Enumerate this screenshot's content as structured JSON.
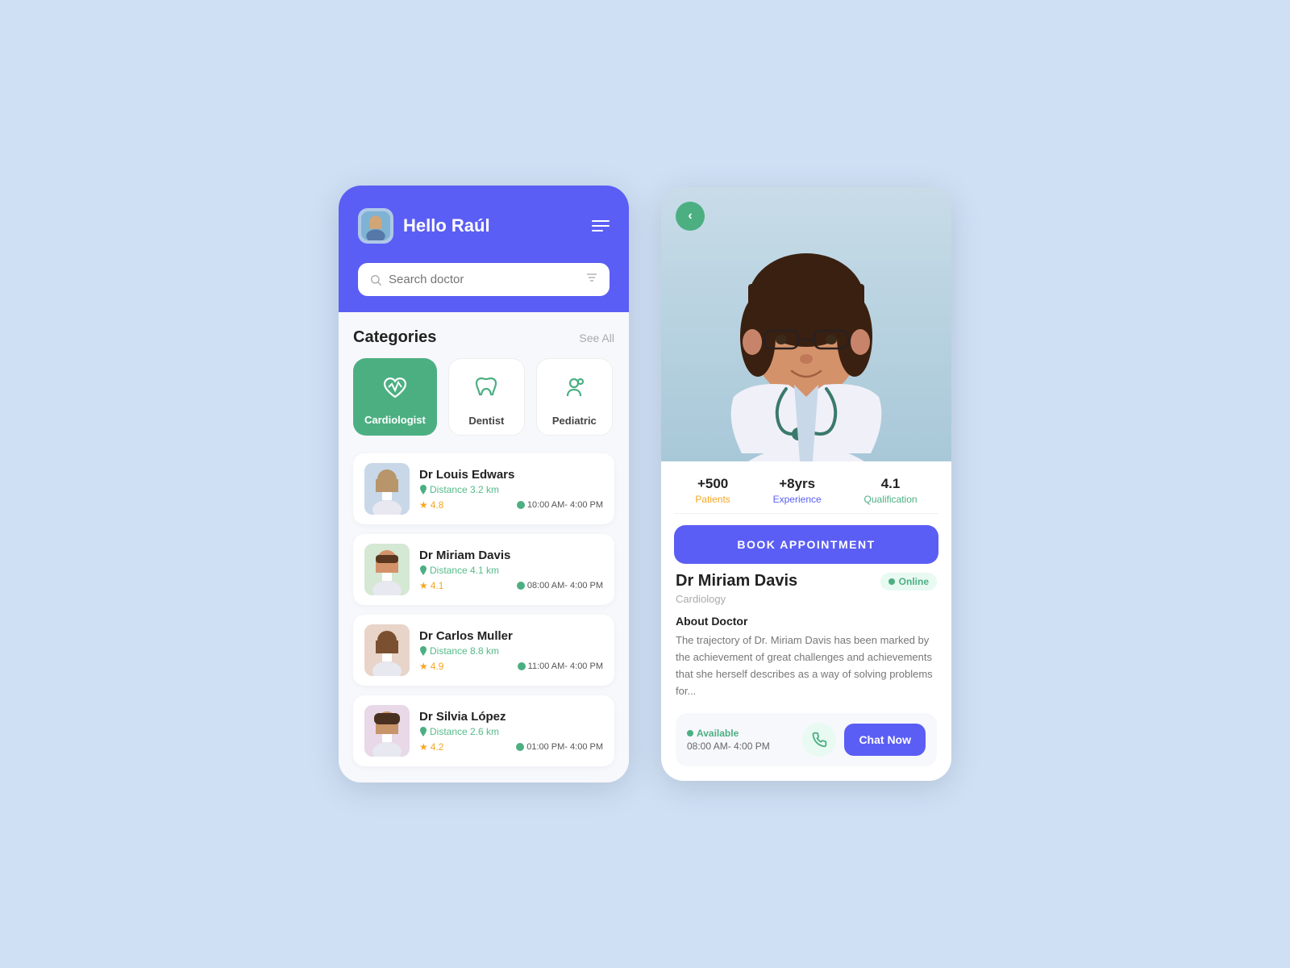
{
  "app": {
    "bg_color": "#cfe0f5"
  },
  "left_phone": {
    "header": {
      "greeting": "Hello Raúl",
      "menu_label": "menu"
    },
    "search": {
      "placeholder": "Search doctor",
      "filter_label": "filter"
    },
    "categories": {
      "title": "Categories",
      "see_all": "See All",
      "items": [
        {
          "label": "Cardiologist",
          "active": true
        },
        {
          "label": "Dentist",
          "active": false
        },
        {
          "label": "Pediatric",
          "active": false
        }
      ]
    },
    "doctors": [
      {
        "name": "Dr Louis Edwars",
        "distance": "Distance 3.2 km",
        "rating": "4.8",
        "time": "10:00 AM- 4:00 PM"
      },
      {
        "name": "Dr Miriam Davis",
        "distance": "Distance 4.1 km",
        "rating": "4.1",
        "time": "08:00 AM- 4:00 PM"
      },
      {
        "name": "Dr Carlos Muller",
        "distance": "Distance 8.8 km",
        "rating": "4.9",
        "time": "11:00 AM- 4:00 PM"
      },
      {
        "name": "Dr Silvia López",
        "distance": "Distance 2.6 km",
        "rating": "4.2",
        "time": "01:00 PM- 4:00 PM"
      }
    ]
  },
  "right_phone": {
    "back_label": "‹",
    "stats": [
      {
        "value": "+500",
        "label": "Patients",
        "color_class": "orange"
      },
      {
        "value": "+8yrs",
        "label": "Experience",
        "color_class": "purple"
      },
      {
        "value": "4.1",
        "label": "Qualification",
        "color_class": "teal"
      }
    ],
    "book_button": "BOOK APPOINTMENT",
    "doctor": {
      "name": "Dr Miriam Davis",
      "online_label": "Online",
      "specialty": "Cardiology",
      "about_title": "About Doctor",
      "about_text": "The trajectory of Dr. Miriam Davis has been marked by the achievement of great challenges and achievements that she herself describes as a way of solving problems for..."
    },
    "available": {
      "label": "Available",
      "time": "08:00 AM- 4:00 PM"
    },
    "phone_icon": "📞",
    "chat_button": "Chat Now"
  }
}
